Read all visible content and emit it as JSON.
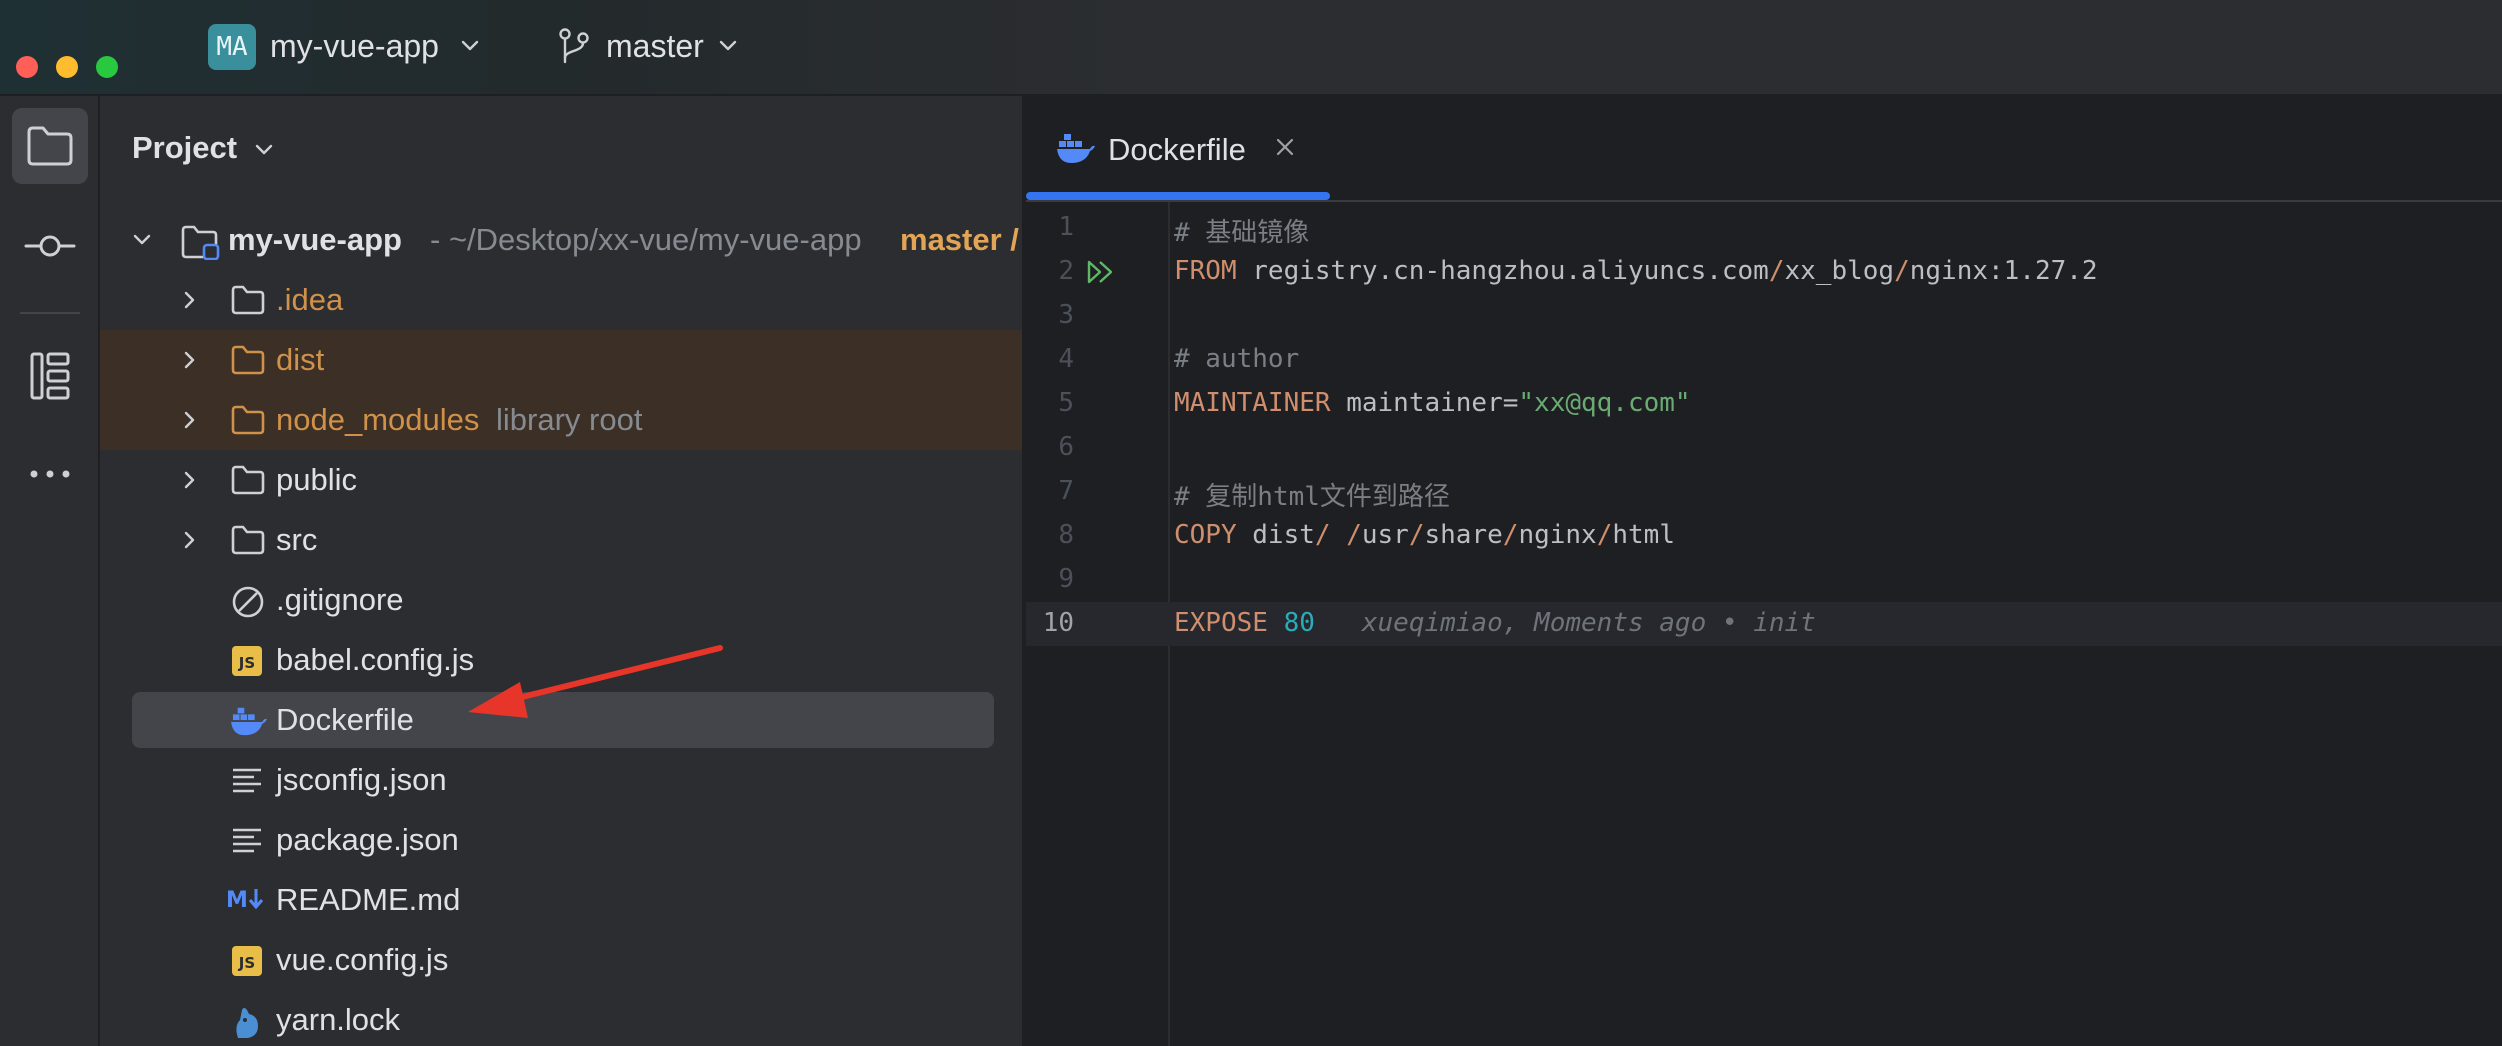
{
  "titlebar": {
    "project_badge": "MA",
    "project_name": "my-vue-app",
    "branch": "master"
  },
  "project_panel": {
    "title": "Project",
    "root": {
      "name": "my-vue-app",
      "path": "~/Desktop/xx-vue/my-vue-app",
      "branch_tag": "master /"
    },
    "items": [
      {
        "label": ".idea",
        "type": "folder"
      },
      {
        "label": "dist",
        "type": "folder-excluded"
      },
      {
        "label": "node_modules",
        "hint": "library root",
        "type": "folder-excluded"
      },
      {
        "label": "public",
        "type": "folder"
      },
      {
        "label": "src",
        "type": "folder"
      },
      {
        "label": ".gitignore",
        "type": "ignore-file"
      },
      {
        "label": "babel.config.js",
        "type": "js-file"
      },
      {
        "label": "Dockerfile",
        "type": "docker-file",
        "selected": true
      },
      {
        "label": "jsconfig.json",
        "type": "json-file"
      },
      {
        "label": "package.json",
        "type": "json-file"
      },
      {
        "label": "README.md",
        "type": "md-file"
      },
      {
        "label": "vue.config.js",
        "type": "js-file"
      },
      {
        "label": "yarn.lock",
        "type": "yarn-file"
      }
    ]
  },
  "editor": {
    "tab_label": "Dockerfile",
    "lines": [
      {
        "n": "1",
        "comment": "# 基础镜像"
      },
      {
        "n": "2",
        "kw": "FROM",
        "rest_a": " registry.cn-hangzhou.aliyuncs.com",
        "sep1": "/",
        "rest_b": "xx_blog",
        "sep2": "/",
        "rest_c": "nginx:1.27.2"
      },
      {
        "n": "3"
      },
      {
        "n": "4",
        "comment": "# author"
      },
      {
        "n": "5",
        "kw": "MAINTAINER",
        "rest": " maintainer=",
        "str": "\"xx@qq.com\""
      },
      {
        "n": "6"
      },
      {
        "n": "7",
        "comment": "# 复制html文件到路径"
      },
      {
        "n": "8",
        "kw": "COPY",
        "p1": " dist",
        "s1": "/",
        "p2": " ",
        "s2": "/",
        "p3": "usr",
        "s3": "/",
        "p4": "share",
        "s4": "/",
        "p5": "nginx",
        "s5": "/",
        "p6": "html"
      },
      {
        "n": "9"
      },
      {
        "n": "10",
        "kw": "EXPOSE",
        "num": "80",
        "blame": "xueqimiao, Moments ago • init"
      }
    ]
  },
  "colors": {
    "accent": "#3574f0",
    "annotation_arrow": "#e8352a",
    "keyword": "#cf8e6d",
    "string": "#6aab73",
    "number": "#2aacb8"
  }
}
